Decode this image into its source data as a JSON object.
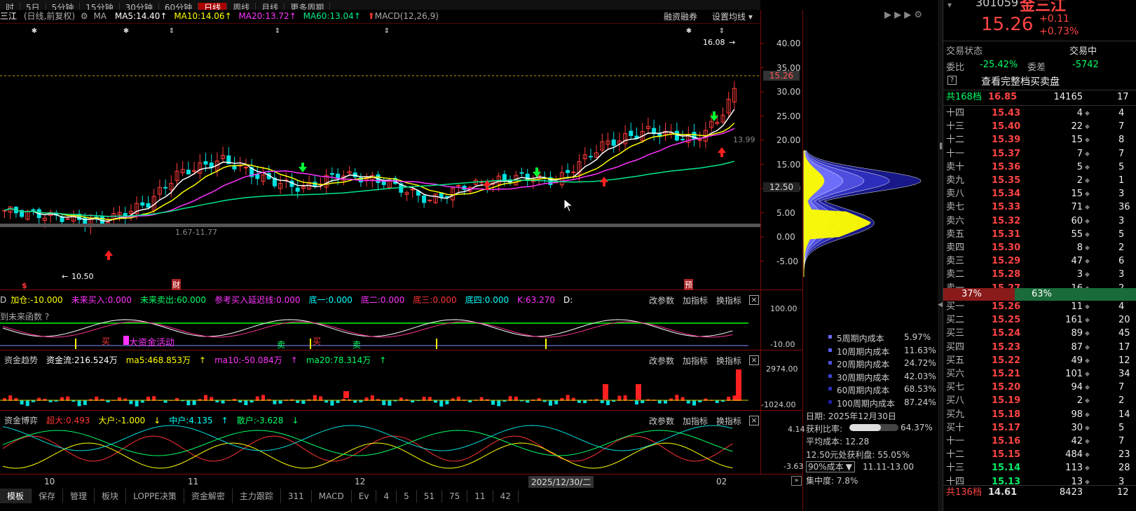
{
  "top_tabs": [
    "日线",
    "周线",
    "月线",
    "更多周期"
  ],
  "top_partial": [
    "时",
    "5日",
    "5分钟",
    "15分钟",
    "30分钟",
    "60分钟"
  ],
  "header": {
    "stock_short": "三江",
    "mode": "(日线,前复权)",
    "ma_label": "MA",
    "ma5": "MA5:14.40",
    "ma10": "MA10:14.06",
    "ma20": "MA20:13.72",
    "ma60": "MA60:13.04",
    "macd": "MACD(12,26,9)",
    "margin_btn": "融资融券",
    "ma_settings": "设置均线"
  },
  "price_axis": [
    "40.00",
    "35.00",
    "30.00",
    "25.00",
    "20.00",
    "15.00",
    "10.00",
    "5.00",
    "0.00",
    "-5.00"
  ],
  "price_current": "15.26",
  "price_mark": "12.50",
  "annotations": {
    "high": "16.08",
    "low": "10.50",
    "range": "1.67-11.77",
    "right_val": "13.99"
  },
  "event_marks": {
    "s": "$",
    "cai": "财",
    "yu": "预"
  },
  "ind1": {
    "items": [
      "加仓:-10.000",
      "未来买入:0.000",
      "未来卖出:60.000",
      "参考买入延迟线:0.000",
      "底一:0.000",
      "底二:0.000",
      "底三:0.000",
      "底四:0.000",
      "K:63.270",
      "D:"
    ],
    "prefix": "D",
    "sub": "到未来函数 ?",
    "buy1": "买",
    "big_funds": "大资金活动",
    "sell1": "卖",
    "buy2": "买",
    "sell2": "卖",
    "axis_top": "100.00",
    "axis_bot": "-10.00"
  },
  "ind2": {
    "name": "资金趋势",
    "items": [
      "资金流:216.524万",
      "ma5:468.853万",
      "ma10:-50.084万",
      "ma20:78.314万"
    ],
    "axis_top": "2974.00",
    "axis_bot": "-1024.00"
  },
  "ind3": {
    "name": "资金博弈",
    "items": [
      "超大:0.493",
      "大户:-1.000",
      "中户:4.135",
      "散户:-3.628"
    ],
    "axis_top": "4.14",
    "axis_bot": "-3.63"
  },
  "panel_buttons": {
    "params": "改参数",
    "add": "加指标",
    "switch": "换指标",
    "close": "×"
  },
  "x_axis": {
    "labels": [
      "10",
      "11",
      "12",
      "02"
    ],
    "cursor_date": "2025/12/30/二"
  },
  "bottom_tabs": [
    "模板",
    "保存",
    "管理",
    "板块",
    "LOPPE决策",
    "资金解密",
    "主力跟踪",
    "311",
    "MACD",
    "Ev",
    "4",
    "5",
    "51",
    "75",
    "11",
    "42"
  ],
  "cost_dist": {
    "items": [
      {
        "label": "5周期内成本",
        "value": "5.97%",
        "color": "#6a6aff"
      },
      {
        "label": "10周期内成本",
        "value": "11.63%",
        "color": "#5c5cf0"
      },
      {
        "label": "20周期内成本",
        "value": "24.72%",
        "color": "#4f4fe0"
      },
      {
        "label": "30周期内成本",
        "value": "42.03%",
        "color": "#3f3fcc"
      },
      {
        "label": "60周期内成本",
        "value": "68.53%",
        "color": "#2e2eb8"
      },
      {
        "label": "100周期内成本",
        "value": "87.24%",
        "color": "#1c1ca0"
      }
    ],
    "date": "日期: 2025年12月30日",
    "profit_ratio_label": "获利比率:",
    "profit_ratio": "64.37%",
    "profit_ratio_fraction": 0.6437,
    "avg_cost": "平均成本: 12.28",
    "profit_at": "12.50元处获利盘: 55.05%",
    "select": "90%成本",
    "range": "11.11-13.00",
    "concentration": "集中度: 7.8%"
  },
  "quote": {
    "code": "301059",
    "name": "金三江",
    "price": "15.26",
    "change": "+0.11",
    "change_pct": "+0.73%",
    "status_label": "交易状态",
    "status_value": "交易中",
    "ratio_label": "委比",
    "ratio_value": "-25.42%",
    "diff_label": "委差",
    "diff_value": "-5742",
    "full_book": "查看完整档买卖盘",
    "total_label": "共168档",
    "total_price": "16.85",
    "total_vol": "14165",
    "total_ex": "17"
  },
  "orderbook_sell": [
    {
      "l": "十四",
      "p": "15.43",
      "v": "4",
      "e": "4"
    },
    {
      "l": "十三",
      "p": "15.40",
      "v": "22",
      "e": "7"
    },
    {
      "l": "十二",
      "p": "15.39",
      "v": "15",
      "e": "8"
    },
    {
      "l": "十一",
      "p": "15.37",
      "v": "7",
      "e": "7"
    },
    {
      "l": "卖十",
      "p": "15.36",
      "v": "5",
      "e": "5"
    },
    {
      "l": "卖九",
      "p": "15.35",
      "v": "2",
      "e": "1"
    },
    {
      "l": "卖八",
      "p": "15.34",
      "v": "15",
      "e": "3"
    },
    {
      "l": "卖七",
      "p": "15.33",
      "v": "71",
      "e": "36"
    },
    {
      "l": "卖六",
      "p": "15.32",
      "v": "60",
      "e": "3"
    },
    {
      "l": "卖五",
      "p": "15.31",
      "v": "55",
      "e": "5"
    },
    {
      "l": "卖四",
      "p": "15.30",
      "v": "8",
      "e": "2"
    },
    {
      "l": "卖三",
      "p": "15.29",
      "v": "47",
      "e": "6"
    },
    {
      "l": "卖二",
      "p": "15.28",
      "v": "3",
      "e": "3"
    },
    {
      "l": "卖一",
      "p": "15.27",
      "v": "16",
      "e": "2"
    }
  ],
  "ratio_bar": {
    "sell": "37%",
    "buy": "63%",
    "sell_fraction": 0.37
  },
  "orderbook_buy": [
    {
      "l": "买一",
      "p": "15.26",
      "v": "11",
      "e": "4"
    },
    {
      "l": "买二",
      "p": "15.25",
      "v": "161",
      "e": "20"
    },
    {
      "l": "买三",
      "p": "15.24",
      "v": "89",
      "e": "45"
    },
    {
      "l": "买四",
      "p": "15.23",
      "v": "87",
      "e": "17"
    },
    {
      "l": "买五",
      "p": "15.22",
      "v": "49",
      "e": "12"
    },
    {
      "l": "买六",
      "p": "15.21",
      "v": "101",
      "e": "34"
    },
    {
      "l": "买七",
      "p": "15.20",
      "v": "94",
      "e": "7"
    },
    {
      "l": "买八",
      "p": "15.19",
      "v": "2",
      "e": "2"
    },
    {
      "l": "买九",
      "p": "15.18",
      "v": "98",
      "e": "14"
    },
    {
      "l": "买十",
      "p": "15.17",
      "v": "30",
      "e": "5"
    },
    {
      "l": "十一",
      "p": "15.16",
      "v": "42",
      "e": "7"
    },
    {
      "l": "十二",
      "p": "15.15",
      "v": "484",
      "e": "23"
    },
    {
      "l": "十三",
      "p": "15.14",
      "v": "113",
      "e": "28"
    },
    {
      "l": "十四",
      "p": "15.13",
      "v": "13",
      "e": "3"
    }
  ],
  "bottom_total": {
    "label": "共136档",
    "price": "14.61",
    "vol": "8423",
    "ex": "12"
  },
  "colors": {
    "up": "#ff3b3b",
    "down": "#00e0e0",
    "green": "#00ff66",
    "ma5": "#ffffff",
    "ma10": "#ffff00",
    "ma20": "#ff33ff",
    "ma60": "#00e68a"
  }
}
